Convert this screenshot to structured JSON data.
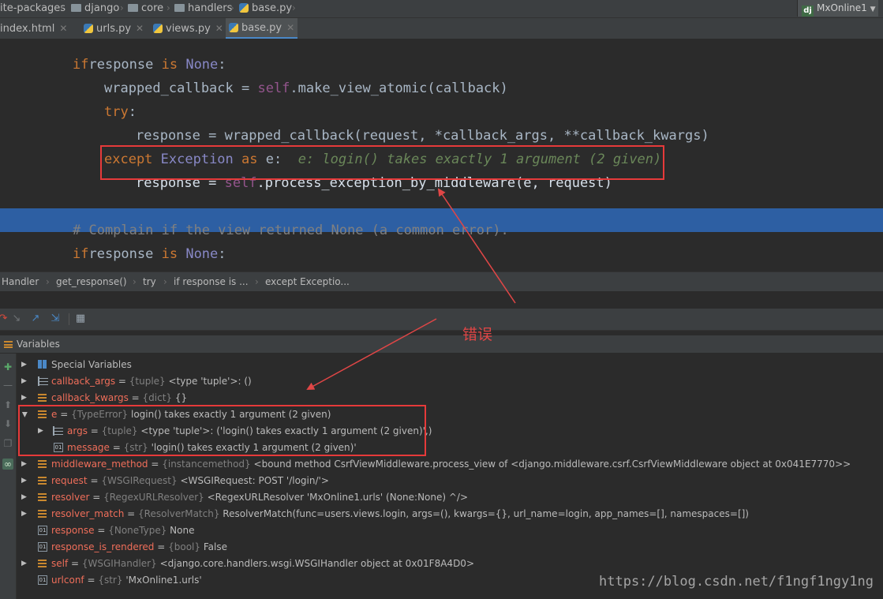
{
  "navbar": {
    "crumbs": [
      "ite-packages",
      "django",
      "core",
      "handlers",
      "base.py"
    ],
    "project": "MxOnline1",
    "project_badge": "dj"
  },
  "tabs": [
    {
      "label": "index.html",
      "active": false
    },
    {
      "label": "urls.py",
      "active": false
    },
    {
      "label": "views.py",
      "active": false
    },
    {
      "label": "base.py",
      "active": true
    }
  ],
  "editor": {
    "lines": [
      {
        "parts": [
          [
            "kw",
            "if"
          ],
          [
            "",
            "response "
          ],
          [
            "kw",
            "is "
          ],
          [
            "none",
            "None"
          ],
          [
            "",
            ":"
          ]
        ]
      },
      {
        "parts": [
          [
            "",
            "wrapped_callback = "
          ],
          [
            "self",
            "self"
          ],
          [
            "",
            ".make_view_atomic(callback)"
          ]
        ]
      },
      {
        "parts": [
          [
            "kw",
            "try"
          ],
          [
            "",
            ":"
          ]
        ]
      },
      {
        "parts": [
          [
            "",
            "response = wrapped_callback(request, "
          ],
          [
            "kw",
            ""
          ],
          [
            "",
            "*callback_args, **callback_kwargs)"
          ]
        ]
      },
      {
        "parts": [
          [
            "kw",
            "except "
          ],
          [
            "cls",
            "Exception "
          ],
          [
            "kw",
            "as "
          ],
          [
            "",
            "e:  "
          ],
          [
            "dbg",
            "e: login() takes exactly 1 argument (2 given)"
          ]
        ]
      },
      {
        "parts": [
          [
            "",
            "response = "
          ],
          [
            "self",
            "self"
          ],
          [
            "",
            ".process_exception_by_middleware(e, request)"
          ]
        ]
      },
      {
        "parts": [
          [
            "",
            ""
          ]
        ]
      },
      {
        "parts": [
          [
            "cmt",
            "# Complain if the view returned None (a common error)."
          ]
        ]
      },
      {
        "parts": [
          [
            "kw",
            "if"
          ],
          [
            "",
            "response "
          ],
          [
            "kw",
            "is "
          ],
          [
            "none",
            "None"
          ],
          [
            "",
            ":"
          ]
        ]
      }
    ]
  },
  "code_breadcrumb": [
    "Handler",
    "get_response()",
    "try",
    "if response is ...",
    "except Exceptio..."
  ],
  "variables_panel": {
    "title": "Variables",
    "rows": [
      {
        "name": "Special Variables",
        "type": "",
        "value": ""
      },
      {
        "name": "callback_args",
        "type": "{tuple}",
        "value": "<type 'tuple'>: ()"
      },
      {
        "name": "callback_kwargs",
        "type": "{dict}",
        "value": "{}"
      },
      {
        "name": "e",
        "type": "{TypeError}",
        "value": "login() takes exactly 1 argument (2 given)"
      },
      {
        "name": "args",
        "type": "{tuple}",
        "value": "<type 'tuple'>: ('login() takes exactly 1 argument (2 given)',)"
      },
      {
        "name": "message",
        "type": "{str}",
        "value": "'login() takes exactly 1 argument (2 given)'"
      },
      {
        "name": "middleware_method",
        "type": "{instancemethod}",
        "value": "<bound method CsrfViewMiddleware.process_view of <django.middleware.csrf.CsrfViewMiddleware object at 0x041E7770>>"
      },
      {
        "name": "request",
        "type": "{WSGIRequest}",
        "value": "<WSGIRequest: POST '/login/'>"
      },
      {
        "name": "resolver",
        "type": "{RegexURLResolver}",
        "value": "<RegexURLResolver 'MxOnline1.urls' (None:None) ^/>"
      },
      {
        "name": "resolver_match",
        "type": "{ResolverMatch}",
        "value": "ResolverMatch(func=users.views.login, args=(), kwargs={}, url_name=login, app_names=[], namespaces=[])"
      },
      {
        "name": "response",
        "type": "{NoneType}",
        "value": "None"
      },
      {
        "name": "response_is_rendered",
        "type": "{bool}",
        "value": "False"
      },
      {
        "name": "self",
        "type": "{WSGIHandler}",
        "value": "<django.core.handlers.wsgi.WSGIHandler object at 0x01F8A4D0>"
      },
      {
        "name": "urlconf",
        "type": "{str}",
        "value": "'MxOnline1.urls'"
      }
    ]
  },
  "annotation": "错误",
  "watermark": "https://blog.csdn.net/f1ngf1ngy1ng",
  "colors": {
    "keyword": "#cc7832",
    "self": "#94558d",
    "exec_line": "#2d5fa3",
    "highlight_box": "#e63a3a",
    "var_name": "#ef6e5a"
  }
}
